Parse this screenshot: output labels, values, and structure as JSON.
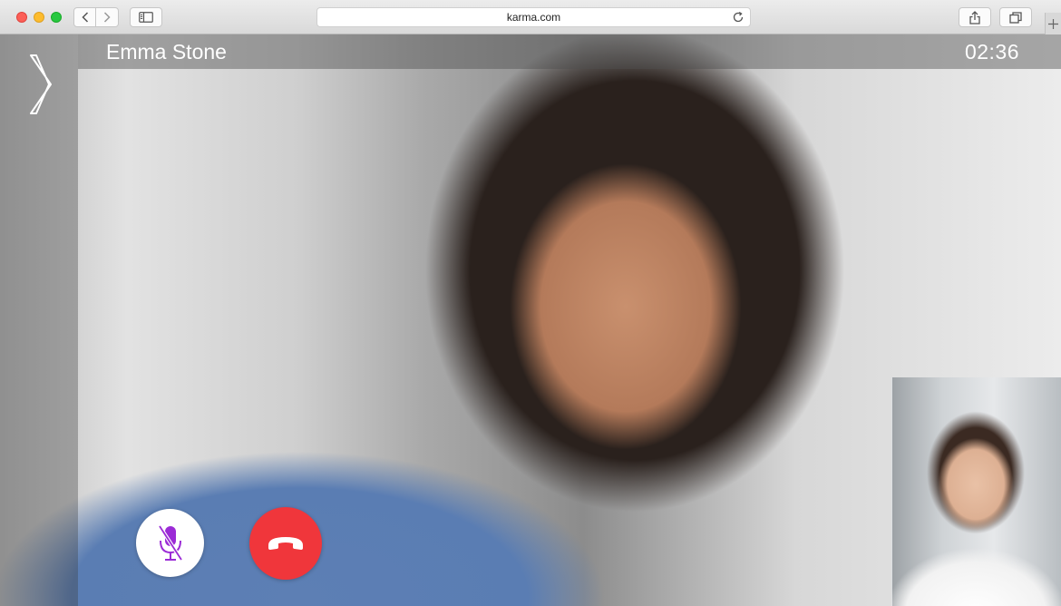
{
  "browser": {
    "url": "karma.com"
  },
  "call": {
    "caller_name": "Emma Stone",
    "duration": "02:36",
    "mic_muted": true
  },
  "icons": {
    "back": "chevron-left-icon",
    "forward": "chevron-right-icon",
    "sidebar": "sidebar-icon",
    "reload": "reload-icon",
    "share": "share-icon",
    "tabs": "tabs-icon",
    "new_tab": "plus-icon",
    "expand": "chevron-right-icon",
    "mute": "microphone-muted-icon",
    "end_call": "phone-hangup-icon"
  },
  "colors": {
    "end_call": "#f0363b",
    "mute_icon": "#9b2bd6",
    "close": "#fc5f57",
    "minimize": "#fdbc2e",
    "zoom": "#28c840"
  }
}
